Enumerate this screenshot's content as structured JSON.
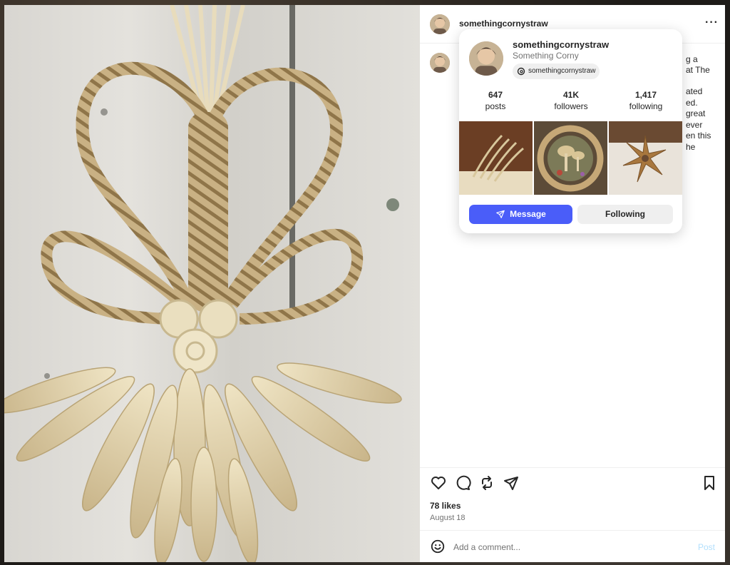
{
  "post": {
    "username": "somethingcornystraw",
    "caption_fragments": [
      "g a",
      "at The",
      "ated",
      "ed.",
      "great",
      "ever",
      "en this",
      "he"
    ],
    "likes": "78 likes",
    "date": "August 18"
  },
  "comment": {
    "placeholder": "Add a comment...",
    "post_label": "Post"
  },
  "hover_card": {
    "username": "somethingcornystraw",
    "full_name": "Something Corny",
    "threads_handle": "somethingcornystraw",
    "stats": [
      {
        "value": "647",
        "label": "posts"
      },
      {
        "value": "41K",
        "label": "followers"
      },
      {
        "value": "1,417",
        "label": "following"
      }
    ],
    "message_label": "Message",
    "following_label": "Following"
  },
  "colors": {
    "primary_blue": "#4a5df9",
    "post_link_disabled": "#b2dffc",
    "secondary_text": "#737373"
  },
  "icons": [
    "more-icon",
    "heart-icon",
    "comment-icon",
    "repost-icon",
    "share-icon",
    "bookmark-icon",
    "emoji-icon",
    "threads-icon",
    "send-icon"
  ]
}
